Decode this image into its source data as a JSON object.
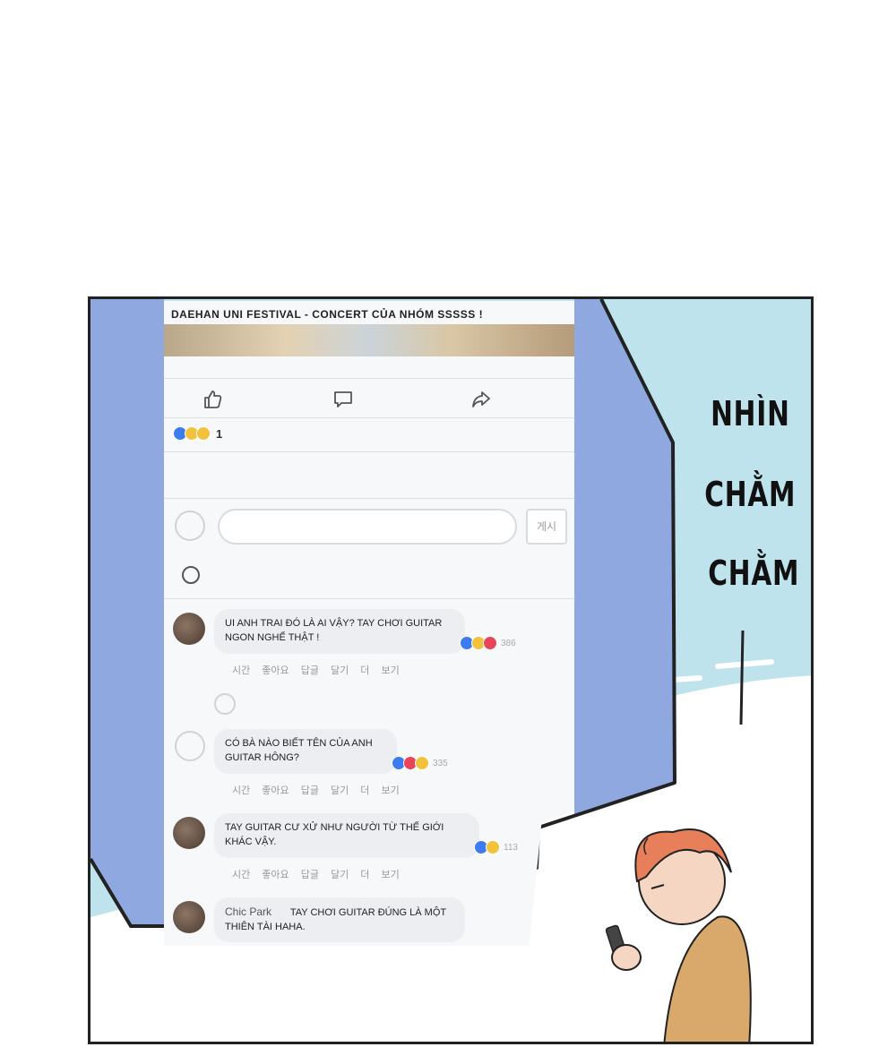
{
  "post": {
    "title": "DAEHAN UNI FESTIVAL - CONCERT CỦA NHÓM SSSSS !",
    "reaction_count": "1",
    "post_button": "게시"
  },
  "icons": {
    "like": "thumbs-up-icon",
    "comment": "speech-bubble-icon",
    "share": "share-arrow-icon",
    "emoji": "smiley-icon"
  },
  "comments": [
    {
      "name": "",
      "text": "UI ANH TRAI ĐÓ LÀ AI VẬY? TAY CHƠI GUITAR NGON NGHẾ THẬT !",
      "reaction_count": "386",
      "meta": "시간 좋아요 답글 달기 더 보기"
    },
    {
      "name": "",
      "text": "CÓ BÀ NÀO BIẾT TÊN CỦA ANH GUITAR HÔNG?",
      "reaction_count": "335",
      "meta": "시간 좋아요 답글 달기 더 보기"
    },
    {
      "name": "",
      "text": "TAY GUITAR CƯ XỬ NHƯ NGƯỜI TỪ THẾ GIỚI KHÁC VẬY.",
      "reaction_count": "113",
      "meta": "시간 좋아요 답글 달기 더 보기"
    },
    {
      "name": "Chic Park",
      "text": "TAY CHƠI GUITAR ĐÚNG LÀ MỘT THIÊN TÀI HAHA.",
      "reaction_count": "",
      "meta": ""
    }
  ],
  "sfx": {
    "line1": "NHÌN",
    "line2": "CHẰM",
    "line3": "CHẰM"
  },
  "colors": {
    "frame_blue": "#8fa9e0",
    "sky": "#bfe3ec",
    "like_blue": "#3d7cf0",
    "haha_yellow": "#f3c23c",
    "love_red": "#e8455a"
  }
}
